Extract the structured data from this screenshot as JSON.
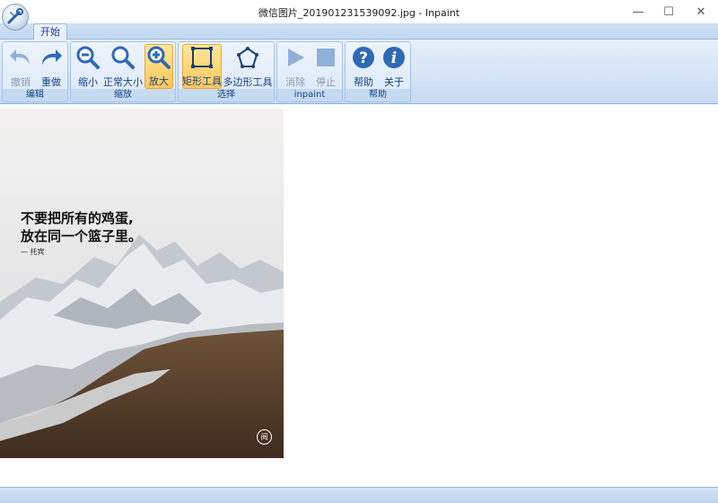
{
  "window": {
    "title": "微信图片_20190123153909​2.jpg - Inpaint",
    "minimize": "—",
    "maximize": "☐",
    "close": "✕"
  },
  "ribbon": {
    "tab_home": "开始",
    "groups": {
      "edit": {
        "label": "编辑",
        "undo": "撤销",
        "redo": "重做"
      },
      "zoom": {
        "label": "缩放",
        "zoom_out": "缩小",
        "normal": "正常大小",
        "zoom_in": "放大"
      },
      "select": {
        "label": "选择",
        "rect_tool": "矩形工具",
        "poly_tool": "多边形工具"
      },
      "inpaint": {
        "label": "inpaint",
        "erase": "消除",
        "stop": "停止"
      },
      "help": {
        "label": "帮助",
        "help": "帮助",
        "about": "关于"
      }
    }
  },
  "image": {
    "quote_line1": "不要把所有的鸡蛋,",
    "quote_line2": "放在同一个篮子里。",
    "author": "— 托宾",
    "stamp": "阅"
  }
}
